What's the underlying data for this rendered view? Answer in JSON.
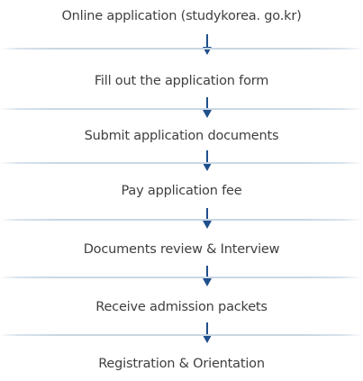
{
  "steps": [
    {
      "label": "Online application (studykorea. go.kr)"
    },
    {
      "label": "Fill out the application form"
    },
    {
      "label": "Submit application documents"
    },
    {
      "label": "Pay application fee"
    },
    {
      "label": "Documents review & Interview"
    },
    {
      "label": "Receive admission packets"
    },
    {
      "label": "Registration & Orientation"
    }
  ],
  "colors": {
    "text": "#3f3f3f",
    "arrow": "#1f4f8c",
    "divider": "#c9d7e4"
  }
}
